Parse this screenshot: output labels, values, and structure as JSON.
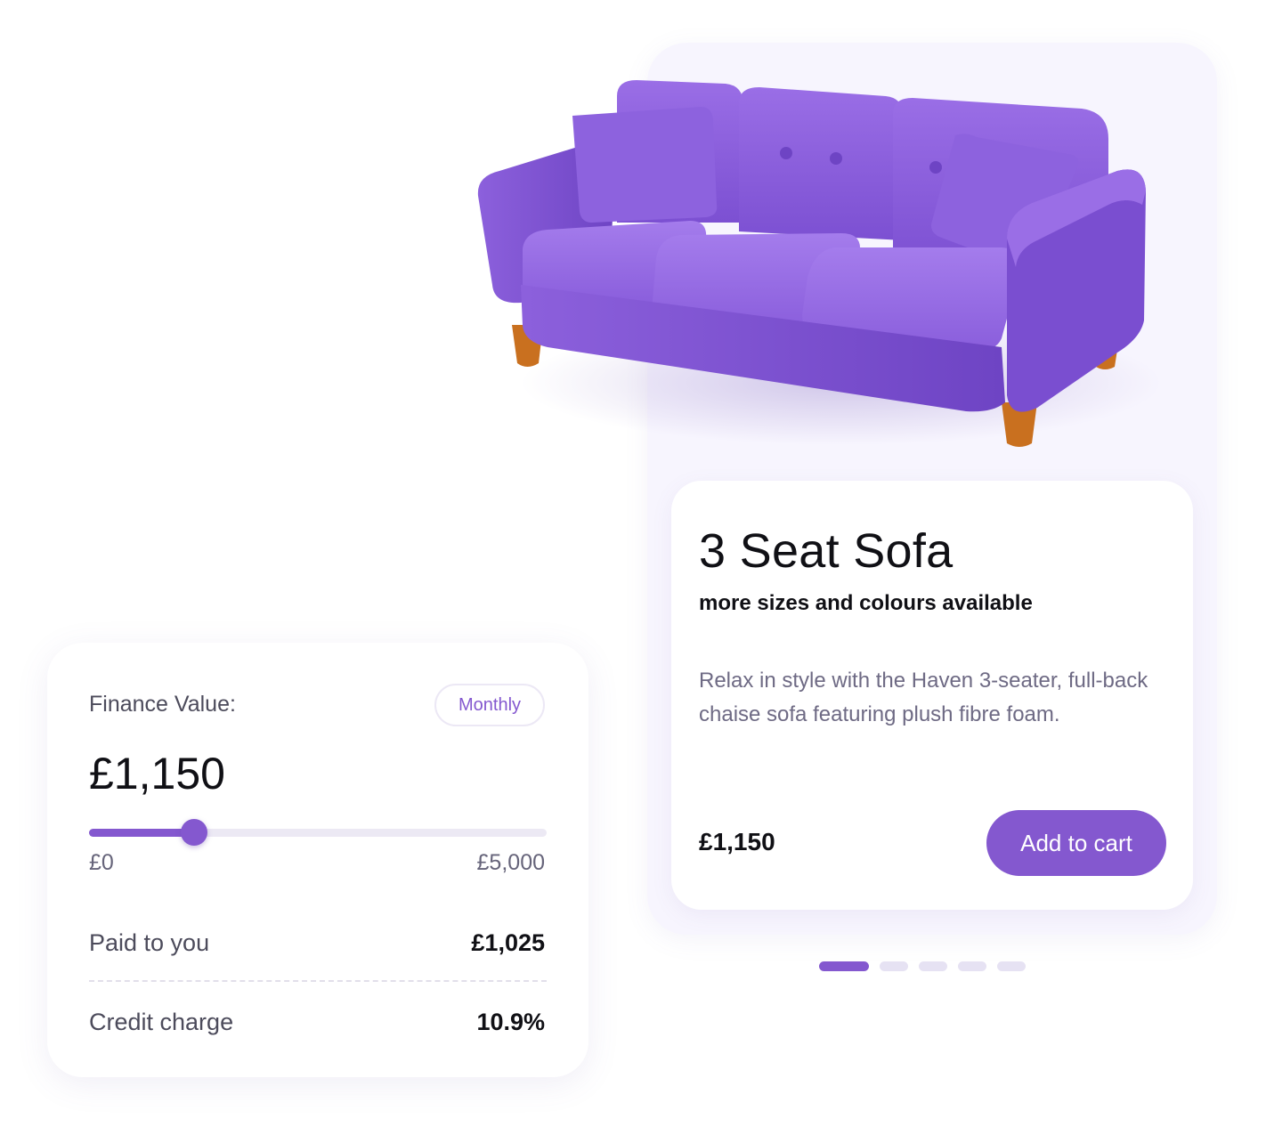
{
  "product": {
    "title": "3 Seat Sofa",
    "subtitle": "more sizes and colours available",
    "description": "Relax in style with the Haven 3-seater, full-back chaise sofa featuring plush fibre foam.",
    "price": "£1,150",
    "add_to_cart_label": "Add to cart",
    "image_icon": "sofa-icon",
    "carousel": {
      "slide_count": 5,
      "active_index": 0
    }
  },
  "finance": {
    "label": "Finance Value:",
    "period": "Monthly",
    "amount": "£1,150",
    "slider": {
      "min_label": "£0",
      "max_label": "£5,000",
      "min": 0,
      "max": 5000,
      "value": 1150
    },
    "rows": [
      {
        "label": "Paid to you",
        "value": "£1,025"
      },
      {
        "label": "Credit charge",
        "value": "10.9%"
      }
    ]
  },
  "colors": {
    "accent": "#8458cf",
    "sofa": "#8b5fde",
    "legs": "#c9701f",
    "panel_bg": "#f7f5fe"
  }
}
